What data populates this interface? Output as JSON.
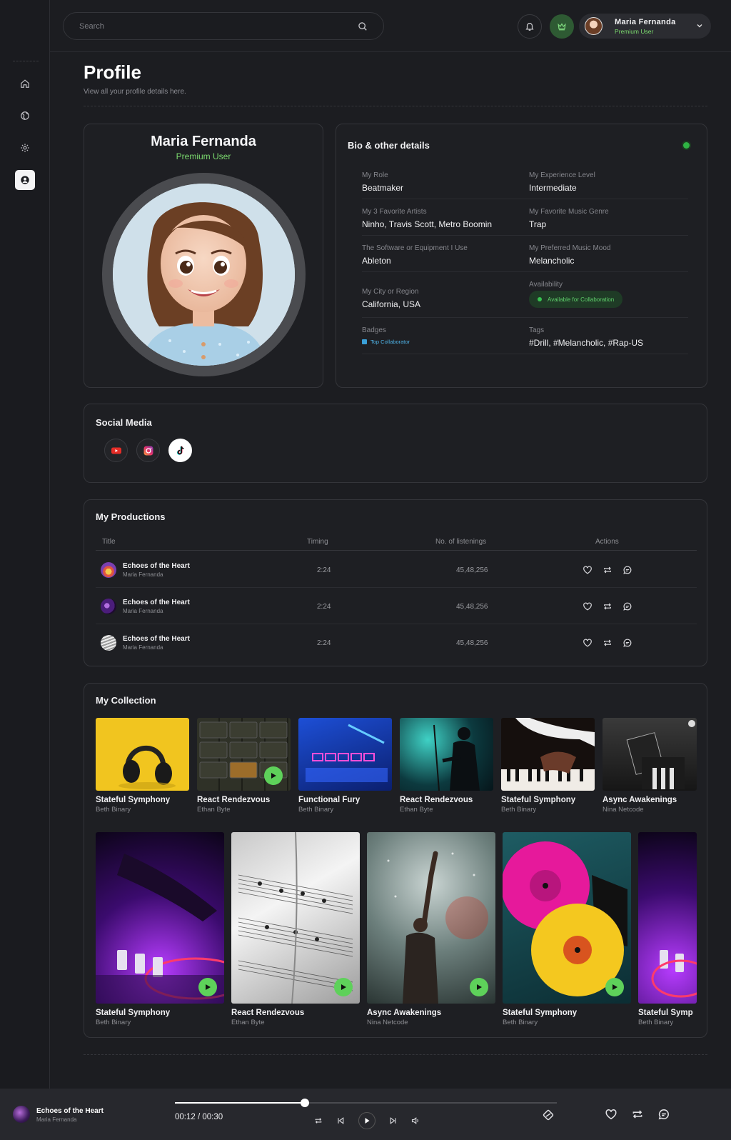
{
  "search": {
    "placeholder": "Search"
  },
  "user": {
    "name": "Maria Fernanda",
    "role": "Premium User"
  },
  "page": {
    "title": "Profile",
    "subtitle": "View all your profile details here."
  },
  "profile": {
    "name": "Maria Fernanda",
    "role": "Premium User"
  },
  "bio": {
    "title": "Bio & other details",
    "rows": [
      [
        {
          "label": "My Role",
          "value": "Beatmaker"
        },
        {
          "label": "My Experience Level",
          "value": "Intermediate"
        }
      ],
      [
        {
          "label": "My 3 Favorite Artists",
          "value": "Ninho, Travis Scott, Metro Boomin"
        },
        {
          "label": "My Favorite Music Genre",
          "value": "Trap"
        }
      ],
      [
        {
          "label": "The Software or Equipment I Use",
          "value": "Ableton"
        },
        {
          "label": "My Preferred Music Mood",
          "value": "Melancholic"
        }
      ],
      [
        {
          "label": "My City or Region",
          "value": "California, USA"
        },
        {
          "label": "Availability",
          "value": "Available for Collaboration"
        }
      ],
      [
        {
          "label": "Badges",
          "value": "Top Collaborator"
        },
        {
          "label": "Tags",
          "value": "#Drill, #Melancholic, #Rap-US"
        }
      ]
    ]
  },
  "social": {
    "title": "Social Media"
  },
  "productions": {
    "title": "My Productions",
    "columns": [
      "Title",
      "Timing",
      "No. of listenings",
      "Actions"
    ],
    "rows": [
      {
        "title": "Echoes of the Heart",
        "artist": "Maria Fernanda",
        "timing": "2:24",
        "listenings": "45,48,256"
      },
      {
        "title": "Echoes of the Heart",
        "artist": "Maria Fernanda",
        "timing": "2:24",
        "listenings": "45,48,256"
      },
      {
        "title": "Echoes of the Heart",
        "artist": "Maria Fernanda",
        "timing": "2:24",
        "listenings": "45,48,256"
      }
    ]
  },
  "collection": {
    "title": "My Collection",
    "row1": [
      {
        "title": "Stateful Symphony",
        "artist": "Beth Binary"
      },
      {
        "title": "React Rendezvous",
        "artist": "Ethan Byte"
      },
      {
        "title": "Functional Fury",
        "artist": "Beth Binary"
      },
      {
        "title": "React Rendezvous",
        "artist": "Ethan Byte"
      },
      {
        "title": "Stateful Symphony",
        "artist": "Beth Binary"
      },
      {
        "title": "Async Awakenings",
        "artist": "Nina Netcode"
      }
    ],
    "row2": [
      {
        "title": "Stateful Symphony",
        "artist": "Beth Binary"
      },
      {
        "title": "React Rendezvous",
        "artist": "Ethan Byte"
      },
      {
        "title": "Async Awakenings",
        "artist": "Nina Netcode"
      },
      {
        "title": "Stateful Symphony",
        "artist": "Beth Binary"
      },
      {
        "title": "Stateful Symp",
        "artist": "Beth Binary"
      }
    ]
  },
  "player": {
    "title": "Echoes of the Heart",
    "artist": "Maria Fernanda",
    "time": "00:12 / 00:30",
    "progress": 0.34
  },
  "colors": {
    "accent_green": "#5ed15a",
    "background": "#1c1d21",
    "card_border": "#34353a"
  }
}
